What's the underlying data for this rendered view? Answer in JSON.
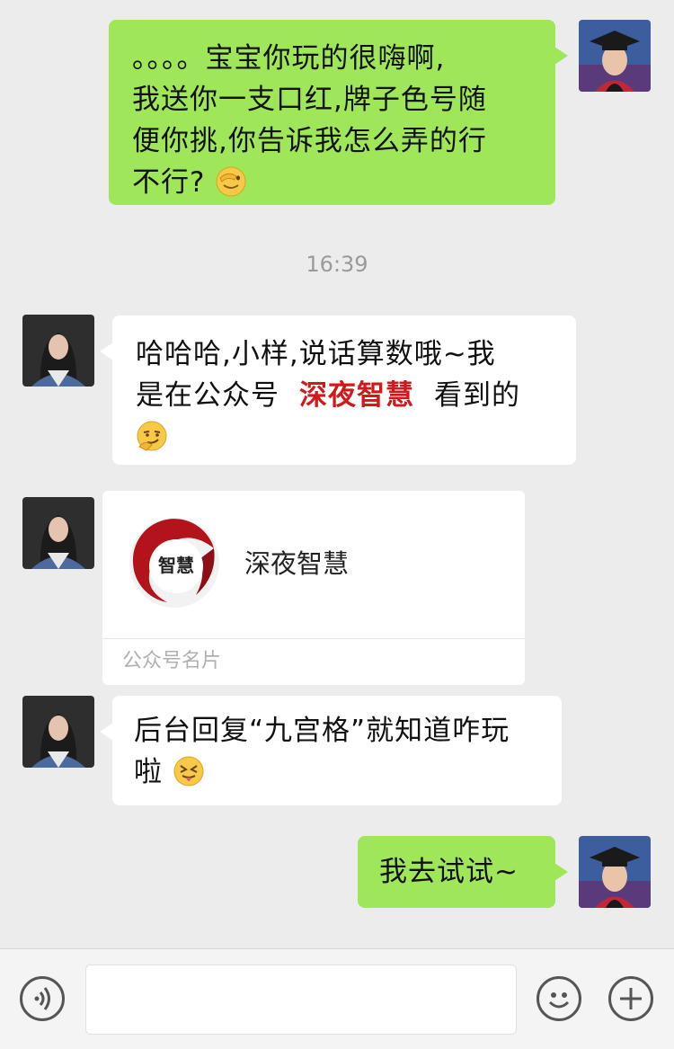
{
  "messages": {
    "m1": {
      "lines": [
        "。。。。宝宝你玩的很嗨啊,",
        "我送你一支口红,牌子色号随",
        "便你挑,你告诉我怎么弄的行",
        "不行?"
      ],
      "emoji": "facepalm-emoji"
    },
    "timestamp": "16:39",
    "m2": {
      "line1": "哈哈哈,小样,说话算数哦~我",
      "line2_prefix": "是在公众号",
      "highlight": "深夜智慧",
      "line2_suffix": "看到的",
      "emoji": "smirk-emoji"
    },
    "card": {
      "name": "深夜智慧",
      "logo_text": "智慧",
      "footer": "公众号名片"
    },
    "m3": {
      "line1": "后台回复“九宫格”就知道咋玩",
      "line2": "啦",
      "emoji": "tongue-emoji"
    },
    "m4": {
      "text": "我去试试~"
    }
  },
  "input_bar": {
    "voice_icon": "voice-icon",
    "emoji_icon": "emoji-icon",
    "add_icon": "plus-icon"
  },
  "colors": {
    "my_bubble": "#9fe658",
    "their_bubble": "#ffffff",
    "highlight": "#d0191b",
    "background": "#ececec"
  }
}
